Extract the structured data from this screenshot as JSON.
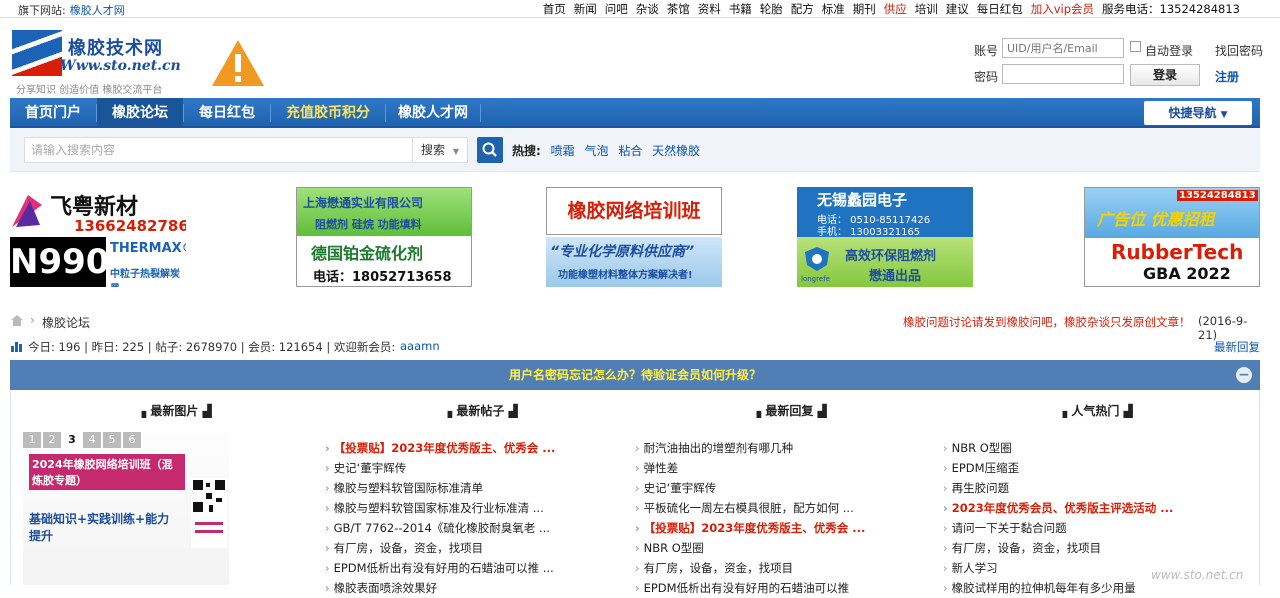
{
  "topbar": {
    "left_label": "旗下网站:",
    "left_link": "橡胶人才网",
    "nav": [
      {
        "label": "首页",
        "red": false
      },
      {
        "label": "新闻",
        "red": false
      },
      {
        "label": "问吧",
        "red": false
      },
      {
        "label": "杂谈",
        "red": false
      },
      {
        "label": "茶馆",
        "red": false
      },
      {
        "label": "资料",
        "red": false
      },
      {
        "label": "书籍",
        "red": false
      },
      {
        "label": "轮胎",
        "red": false
      },
      {
        "label": "配方",
        "red": false
      },
      {
        "label": "标准",
        "red": false
      },
      {
        "label": "期刊",
        "red": false
      },
      {
        "label": "供应",
        "red": true
      },
      {
        "label": "培训",
        "red": false
      },
      {
        "label": "建议",
        "red": false
      },
      {
        "label": "每日红包",
        "red": false
      },
      {
        "label": "加入vip会员",
        "red": true
      }
    ],
    "phone": "服务电话：13524284813"
  },
  "logo": {
    "title": "橡胶技术网",
    "url": "Www.sto.net.cn",
    "slogan": "分享知识 创造价值 橡胶交流平台"
  },
  "login": {
    "account_label": "账号",
    "account_placeholder": "UID/用户名/Email",
    "auto_login": "自动登录",
    "find_password": "找回密码",
    "password_label": "密码",
    "login_button": "登录",
    "register": "注册"
  },
  "nav": {
    "items": [
      "首页门户",
      "橡胶论坛",
      "每日红包",
      "充值胶币积分",
      "橡胶人才网"
    ],
    "quick": "快捷导航"
  },
  "search": {
    "placeholder": "请输入搜索内容",
    "scope": "搜索",
    "hot_label": "热搜:",
    "hot": [
      "喷霜",
      "气泡",
      "粘合",
      "天然橡胶"
    ]
  },
  "banners": {
    "b1": {
      "brand": "飞粤新材",
      "phone": "13662482786",
      "model": "N990",
      "brand2": "THERMAX®",
      "sub": "中粒子热裂解炭黑"
    },
    "b2": {
      "top": "上海懋通实业有限公司",
      "mid": "阻燃剂  硅烷  功能填料",
      "main": "德国铂金硫化剂",
      "tel": "电话：18052713658"
    },
    "b3": {
      "title": "橡胶网络培训班",
      "slogan": "“专业化学原料供应商”",
      "sub": "功能橡塑材料整体方案解决者!"
    },
    "b4": {
      "title": "无锡蠡园电子",
      "tel": "电话： 0510-85117426",
      "mobile": "手机： 13003321165",
      "l1": "高效环保阻燃剂",
      "l2": "懋通出品",
      "brand": "longrefe"
    },
    "b5": {
      "phone": "13524284813",
      "slogan": "广告位 优惠招租",
      "brand": "RubberTech",
      "sub": "GBA 2022"
    }
  },
  "crumb": {
    "label": "橡胶论坛",
    "notice": "橡胶问题讨论请发到橡胶问吧，橡胶杂谈只发原创文章！",
    "date": "(2016-9-21)"
  },
  "stats": {
    "text": "今日: 196 | 昨日: 225 | 帖子: 2678970 | 会员: 121654 | 欢迎新会员:",
    "new_member": "aaamn",
    "latest": "最新回复"
  },
  "notice": "用户名密码忘记怎么办？待验证会员如何升级？",
  "columns": {
    "c1": "最新图片",
    "c2": "最新帖子",
    "c3": "最新回复",
    "c4": "人气热门",
    "pager": [
      "1",
      "2",
      "3",
      "4",
      "5",
      "6"
    ],
    "promo": {
      "title": "2024年橡胶网络培训班（混炼胶专题）",
      "sub": "基础知识+实践训练+能力提升"
    },
    "posts": [
      {
        "t": "【投票贴】2023年度优秀版主、优秀会 ...",
        "red": true
      },
      {
        "t": "史记‘董宇辉传",
        "red": false
      },
      {
        "t": "橡胶与塑料软管国际标准清单",
        "red": false
      },
      {
        "t": "橡胶与塑料软管国家标准及行业标准清 ...",
        "red": false
      },
      {
        "t": "GB/T 7762--2014《硫化橡胶耐臭氧老 ...",
        "red": false
      },
      {
        "t": "有厂房，设备，资金，找项目",
        "red": false
      },
      {
        "t": "EPDM低析出有没有好用的石蜡油可以推 ...",
        "red": false
      },
      {
        "t": "橡胶表面喷涂效果好",
        "red": false
      }
    ],
    "replies": [
      {
        "t": "耐汽油抽出的增塑剂有哪几种",
        "red": false
      },
      {
        "t": "弹性差",
        "red": false
      },
      {
        "t": "史记‘董宇辉传",
        "red": false
      },
      {
        "t": "平板硫化一周左右模具很脏，配方如何 ...",
        "red": false
      },
      {
        "t": "【投票贴】2023年度优秀版主、优秀会 ...",
        "red": true
      },
      {
        "t": "NBR O型圈",
        "red": false
      },
      {
        "t": "有厂房，设备，资金，找项目",
        "red": false
      },
      {
        "t": "EPDM低析出有没有好用的石蜡油可以推",
        "red": false
      }
    ],
    "hot": [
      {
        "t": "NBR O型圈",
        "red": false
      },
      {
        "t": "EPDM压缩歪",
        "red": false
      },
      {
        "t": "再生胶问题",
        "red": false
      },
      {
        "t": "2023年度优秀会员、优秀版主评选活动 ...",
        "red": true
      },
      {
        "t": "请问一下关于黏合问题",
        "red": false
      },
      {
        "t": "有厂房，设备，资金，找项目",
        "red": false
      },
      {
        "t": "新人学习",
        "red": false
      },
      {
        "t": "橡胶试样用的拉伸机每年有多少用量",
        "red": false
      }
    ]
  },
  "watermark": "www.sto.net.cn"
}
